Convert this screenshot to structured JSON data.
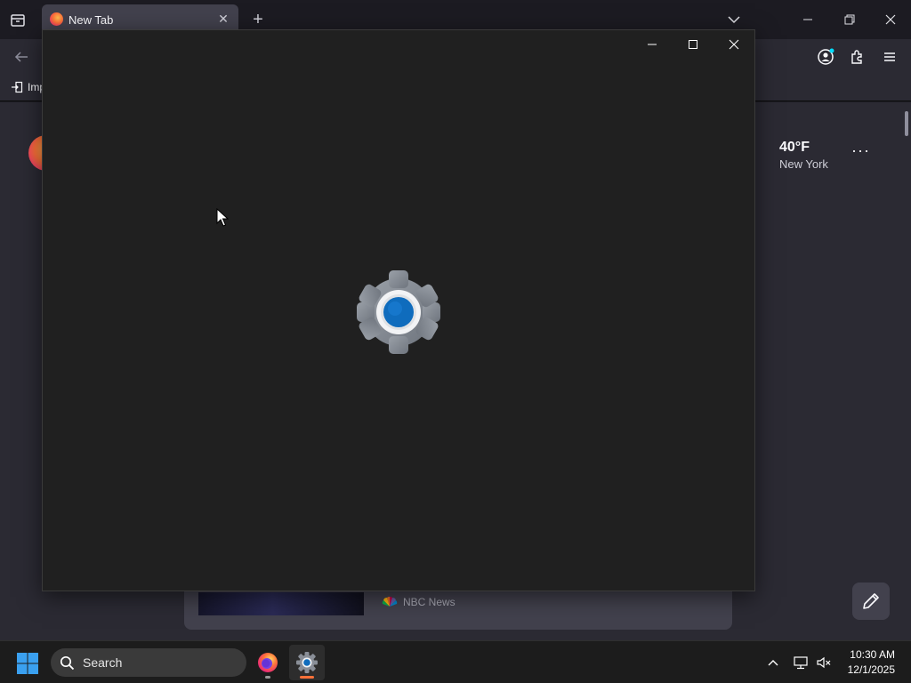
{
  "browser": {
    "tab_title": "New Tab",
    "bookmark_import_label": "Imp",
    "weather": {
      "temperature": "40°F",
      "city": "New York"
    },
    "weather_more": "···",
    "news_source": "NBC News"
  },
  "taskbar": {
    "search_placeholder": "Search",
    "time": "10:30 AM",
    "date": "12/1/2025"
  },
  "colors": {
    "settings_blue": "#0f6cbd",
    "gear_gray": "#8a8f98",
    "firefox_orange": "#ff7139"
  }
}
